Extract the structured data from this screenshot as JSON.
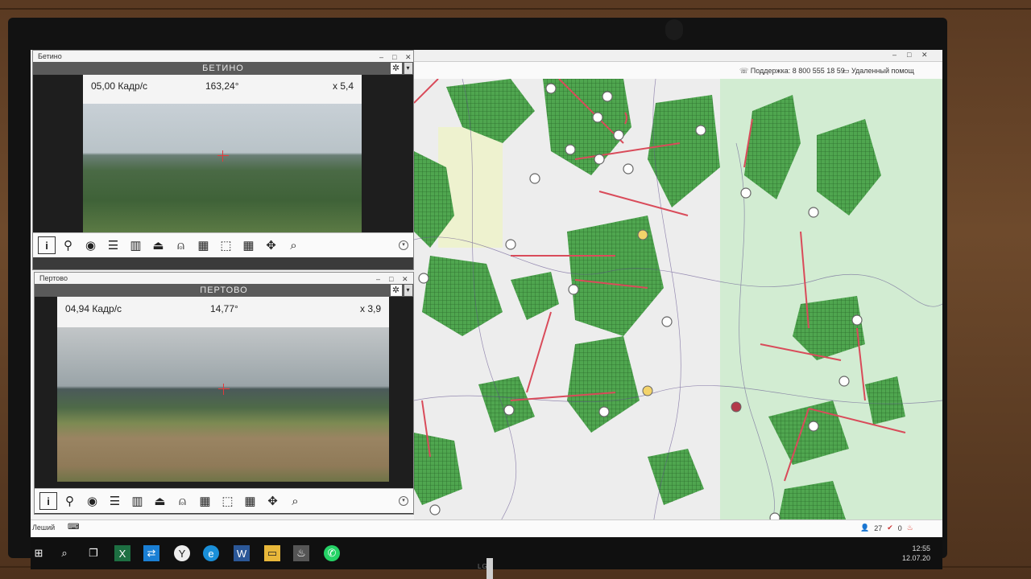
{
  "monitor": {
    "brand": "LG"
  },
  "cam1": {
    "window_title": "Бетино",
    "header": "БЕТИНО",
    "fps": "05,00 Кадр/с",
    "azimuth": "163,24°",
    "zoom": "x 5,4"
  },
  "cam2": {
    "window_title": "Пертово",
    "header": "ПЕРТОВО",
    "fps": "04,94 Кадр/с",
    "azimuth": "14,77°",
    "zoom": "x 3,9"
  },
  "map": {
    "support": "Поддержка: 8 800 555 18 59",
    "remote": "Удаленный помощ"
  },
  "statusbar": {
    "left_label": "Леший",
    "count": "27",
    "alerts": "0"
  },
  "taskbar": {
    "time": "12:55",
    "date": "12.07.20"
  }
}
